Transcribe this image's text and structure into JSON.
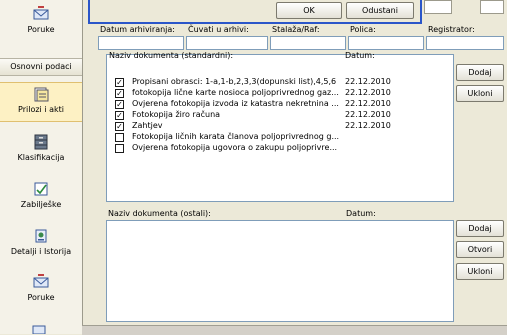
{
  "sidebar": {
    "items": [
      {
        "label": "Poruke",
        "icon": "envelope-icon"
      },
      {
        "label": "Osnovni podaci",
        "icon": "section-header"
      },
      {
        "label": "Prilozi i akti",
        "icon": "attachments-icon"
      },
      {
        "label": "Klasifikacija",
        "icon": "drawer-icon"
      },
      {
        "label": "Zabilješke",
        "icon": "note-icon"
      },
      {
        "label": "Detalji i Istorija",
        "icon": "details-icon"
      },
      {
        "label": "Poruke",
        "icon": "envelope-icon"
      }
    ]
  },
  "dialog": {
    "ok_label": "OK",
    "cancel_label": "Odustani"
  },
  "archive": {
    "labels": [
      "Datum arhiviranja:",
      "Čuvati u arhivi:",
      "Stalaža/Raf:",
      "Polica:",
      "Registrator:"
    ]
  },
  "standard_docs": {
    "header_name": "Naziv dokumenta (standardni):",
    "header_date": "Datum:",
    "rows": [
      {
        "name": "Propisani obrasci: 1-a,1-b,2,3,3(dopunski list),4,5,6",
        "date": "22.12.2010",
        "checked": true
      },
      {
        "name": "fotokopija lične karte nosioca poljoprivrednog gaz...",
        "date": "22.12.2010",
        "checked": true
      },
      {
        "name": "Ovjerena fotokopija izvoda iz katastra nekretnina ...",
        "date": "22.12.2010",
        "checked": true
      },
      {
        "name": "Fotokopija žiro računa",
        "date": "22.12.2010",
        "checked": true
      },
      {
        "name": "Zahtjev",
        "date": "22.12.2010",
        "checked": true
      },
      {
        "name": "Fotokopija ličnih karata članova poljoprivrednog g...",
        "date": "",
        "checked": false
      },
      {
        "name": "Ovjerena fotokopija ugovora o zakupu poljoprivre...",
        "date": "",
        "checked": false
      }
    ],
    "buttons": [
      "Dodaj",
      "Ukloni"
    ]
  },
  "other_docs": {
    "header_name": "Naziv dokumenta (ostali):",
    "header_date": "Datum:",
    "buttons": [
      "Dodaj",
      "Otvori",
      "Ukloni"
    ]
  }
}
